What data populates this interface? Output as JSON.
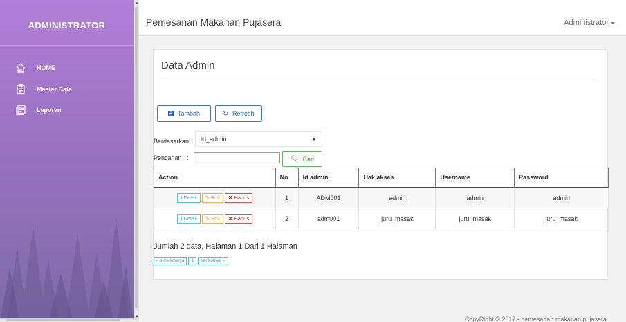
{
  "sidebar": {
    "title": "ADMINISTRATOR",
    "items": [
      {
        "label": "HOME",
        "icon": "home-icon"
      },
      {
        "label": "Master Data",
        "icon": "clipboard-icon"
      },
      {
        "label": "Laporan",
        "icon": "report-icon"
      }
    ]
  },
  "topbar": {
    "title": "Pemesanan Makanan Pujasera",
    "user": "Administrator"
  },
  "panel": {
    "title": "Data Admin",
    "buttons": {
      "tambah": "Tambah",
      "refresh": "Refresh"
    },
    "filter": {
      "berdasarkan_label": "Berdasarkan:",
      "selected": "id_admin",
      "pencarian_label": "Pencarian",
      "search_value": "",
      "cari_label": "Cari"
    },
    "table": {
      "headers": [
        "Action",
        "No",
        "Id admin",
        "Hak akses",
        "Username",
        "Password"
      ],
      "action_labels": {
        "detail": "Detail",
        "edit": "Edit",
        "hapus": "Hapus"
      },
      "rows": [
        {
          "no": "1",
          "id_admin": "ADM001",
          "hak_akses": "admin",
          "username": "admin",
          "password": "admin"
        },
        {
          "no": "2",
          "id_admin": "adm001",
          "hak_akses": "juru_masak",
          "username": "juru_masak",
          "password": "juru_masak"
        }
      ]
    },
    "summary": "Jumlah 2 data, Halaman 1 Dari 1 Halaman",
    "pager": {
      "prev": "« sebelumnya",
      "page": "1",
      "next": "berikutnya »"
    }
  },
  "footer": {
    "text": "CopyRight © 2017 - pemesanan makanan pujasera"
  },
  "colors": {
    "sidebar": "#9a72c2",
    "primary": "#3d6fdb",
    "success": "#5cb85c",
    "info": "#4fc3e3",
    "warning": "#f0ad4e",
    "danger": "#d9534f"
  }
}
